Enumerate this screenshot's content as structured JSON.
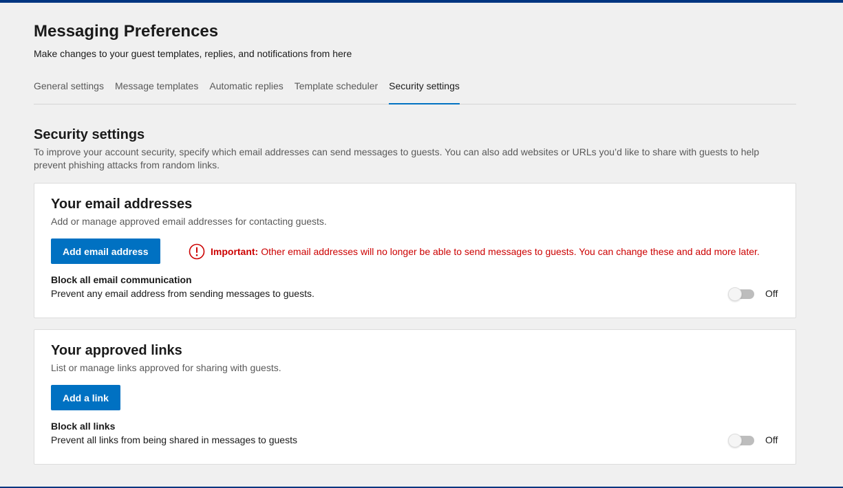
{
  "header": {
    "title": "Messaging Preferences",
    "subtitle": "Make changes to your guest templates, replies, and notifications from here"
  },
  "tabs": [
    {
      "label": "General settings",
      "active": false
    },
    {
      "label": "Message templates",
      "active": false
    },
    {
      "label": "Automatic replies",
      "active": false
    },
    {
      "label": "Template scheduler",
      "active": false
    },
    {
      "label": "Security settings",
      "active": true
    }
  ],
  "security": {
    "title": "Security settings",
    "description": "To improve your account security, specify which email addresses can send messages to guests. You can also add websites or URLs you’d like to share with guests to help prevent phishing attacks from random links."
  },
  "email_card": {
    "title": "Your email addresses",
    "description": "Add or manage approved email addresses for contacting guests.",
    "button_label": "Add email address",
    "alert_icon": "exclamation-circle-icon",
    "alert_strong": "Important:",
    "alert_text": "Other email addresses will no longer be able to send messages to guests. You can change these and add more later.",
    "block_title": "Block all email communication",
    "block_desc": "Prevent any email address from sending messages to guests.",
    "toggle_label": "Off"
  },
  "links_card": {
    "title": "Your approved links",
    "description": "List or manage links approved for sharing with guests.",
    "button_label": "Add a link",
    "block_title": "Block all links",
    "block_desc": "Prevent all links from being shared in messages to guests",
    "toggle_label": "Off"
  },
  "colors": {
    "brand_dark": "#003580",
    "primary": "#0071c2",
    "alert": "#cc0000"
  }
}
